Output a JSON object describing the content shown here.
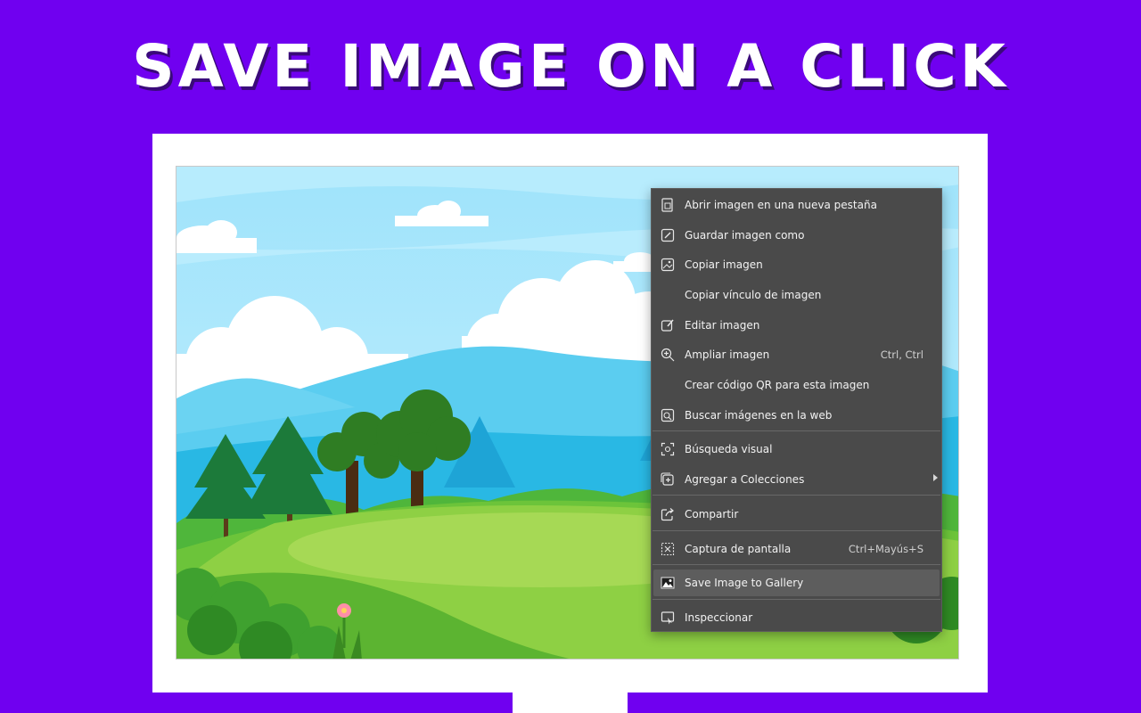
{
  "headline": "SAVE IMAGE ON A CLICK",
  "context_menu": {
    "items": [
      {
        "label": "Abrir imagen en una nueva pestaña",
        "icon": "open-in-new-tab-icon"
      },
      {
        "label": "Guardar imagen como",
        "icon": "save-image-as-icon"
      },
      {
        "label": "Copiar imagen",
        "icon": "copy-image-icon"
      },
      {
        "label": "Copiar vínculo de imagen",
        "icon": ""
      },
      {
        "label": "Editar imagen",
        "icon": "edit-image-icon"
      },
      {
        "label": "Ampliar imagen",
        "icon": "zoom-in-icon",
        "shortcut": "Ctrl, Ctrl"
      },
      {
        "label": "Crear código QR para esta imagen",
        "icon": ""
      },
      {
        "label": "Buscar imágenes en la web",
        "icon": "search-image-web-icon"
      },
      {
        "label": "Búsqueda visual",
        "icon": "visual-search-icon"
      },
      {
        "label": "Agregar a Colecciones",
        "icon": "add-collection-icon"
      },
      {
        "label": "Compartir",
        "icon": "share-icon"
      },
      {
        "label": "Captura de pantalla",
        "icon": "screenshot-icon",
        "shortcut": "Ctrl+Mayús+S"
      },
      {
        "label": "Save Image to Gallery",
        "icon": "gallery-icon"
      },
      {
        "label": "Inspeccionar",
        "icon": "inspect-icon"
      }
    ]
  },
  "colors": {
    "background": "#7000f0",
    "menu_bg": "#4a4a4a",
    "menu_highlight": "#5d5d5d"
  }
}
